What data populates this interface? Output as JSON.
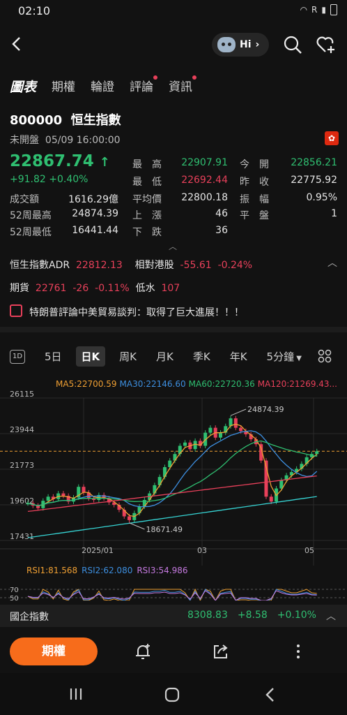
{
  "status": {
    "time": "02:10",
    "signal_label": "R"
  },
  "top": {
    "hi_label": "Hi"
  },
  "tabs": [
    {
      "label": "圖表",
      "active": true,
      "dot": false
    },
    {
      "label": "期權",
      "active": false,
      "dot": false
    },
    {
      "label": "輪證",
      "active": false,
      "dot": false
    },
    {
      "label": "評論",
      "active": false,
      "dot": true
    },
    {
      "label": "資訊",
      "active": false,
      "dot": true
    }
  ],
  "quote": {
    "code": "800000",
    "name": "恒生指數",
    "title": "800000  恒生指數",
    "status": "未開盤",
    "datetime": "05/09 16:00:00",
    "price": "22867.74",
    "change": "+91.82",
    "change_pct": "+0.40%",
    "stats": [
      {
        "label": "成交額",
        "value": "1616.29億"
      },
      {
        "label": "52周最高",
        "value": "24874.39"
      },
      {
        "label": "52周最低",
        "value": "16441.44"
      },
      {
        "label": "最　高",
        "value": "22907.91"
      },
      {
        "label": "最　低",
        "value": "22692.44"
      },
      {
        "label": "平均價",
        "value": "22800.18"
      },
      {
        "label": "上　漲",
        "value": "46"
      },
      {
        "label": "下　跌",
        "value": "36"
      },
      {
        "label": "今　開",
        "value": "22856.21"
      },
      {
        "label": "昨　收",
        "value": "22775.92"
      },
      {
        "label": "振　幅",
        "value": "0.95%"
      },
      {
        "label": "平　盤",
        "value": "1"
      }
    ]
  },
  "adr": {
    "label": "恒生指數ADR",
    "value": "22812.13",
    "rel_label": "相對港股",
    "rel_change": "-55.61",
    "rel_pct": "-0.24%"
  },
  "futures": {
    "label": "期貨",
    "value": "22761",
    "change": "-26",
    "pct": "-0.11%",
    "basis_label": "低水",
    "basis": "107"
  },
  "news": {
    "text": "特朗普評論中美貿易談判：取得了巨大進展！！！"
  },
  "kline_tabs": [
    {
      "label": "1D"
    },
    {
      "label": "5日"
    },
    {
      "label": "日K",
      "active": true
    },
    {
      "label": "周K"
    },
    {
      "label": "月K"
    },
    {
      "label": "季K"
    },
    {
      "label": "年K"
    },
    {
      "label": "5分鐘"
    }
  ],
  "ma_legend": [
    {
      "text": "MA5:22700.59",
      "color": "#f0a033"
    },
    {
      "text": "MA30:22146.60",
      "color": "#3d8fe0"
    },
    {
      "text": "MA60:22720.36",
      "color": "#2fbf71"
    },
    {
      "text": "MA120:21269.43...",
      "color": "#e8405a"
    }
  ],
  "rsi_legend": [
    {
      "text": "RSI1:81.568",
      "color": "#f0a033"
    },
    {
      "text": "RSI2:62.080",
      "color": "#3d8fe0"
    },
    {
      "text": "RSI3:54.986",
      "color": "#c57ae0"
    }
  ],
  "chart_data": {
    "type": "candlestick",
    "y_ticks": [
      "26115",
      "23944",
      "21773",
      "19602",
      "17431"
    ],
    "ylim": [
      17431,
      26115
    ],
    "x_ticks": [
      "2025/01",
      "03",
      "05"
    ],
    "annotations": [
      {
        "text": "24874.39"
      },
      {
        "text": "18671.49"
      }
    ],
    "last_price": 22867.74,
    "rsi_ticks": [
      "70",
      "50"
    ],
    "close_series": [
      19700,
      19550,
      19400,
      19850,
      20100,
      19950,
      20300,
      20150,
      19800,
      20050,
      20700,
      20350,
      20000,
      19900,
      20200,
      20000,
      19750,
      19600,
      19300,
      18900,
      18671,
      19100,
      19500,
      19900,
      20300,
      20800,
      21300,
      21900,
      22300,
      22700,
      23200,
      23400,
      23000,
      23500,
      23200,
      24000,
      24300,
      23700,
      24000,
      24400,
      24874,
      24300,
      24100,
      23900,
      23600,
      23300,
      22300,
      20100,
      19800,
      20600,
      21100,
      21400,
      21600,
      21800,
      22100,
      22500,
      22700,
      22867
    ]
  },
  "bottom_ticker": {
    "name": "國企指數",
    "value": "8308.83",
    "change": "+8.58",
    "pct": "+0.10%"
  },
  "action": {
    "primary": "期權"
  }
}
